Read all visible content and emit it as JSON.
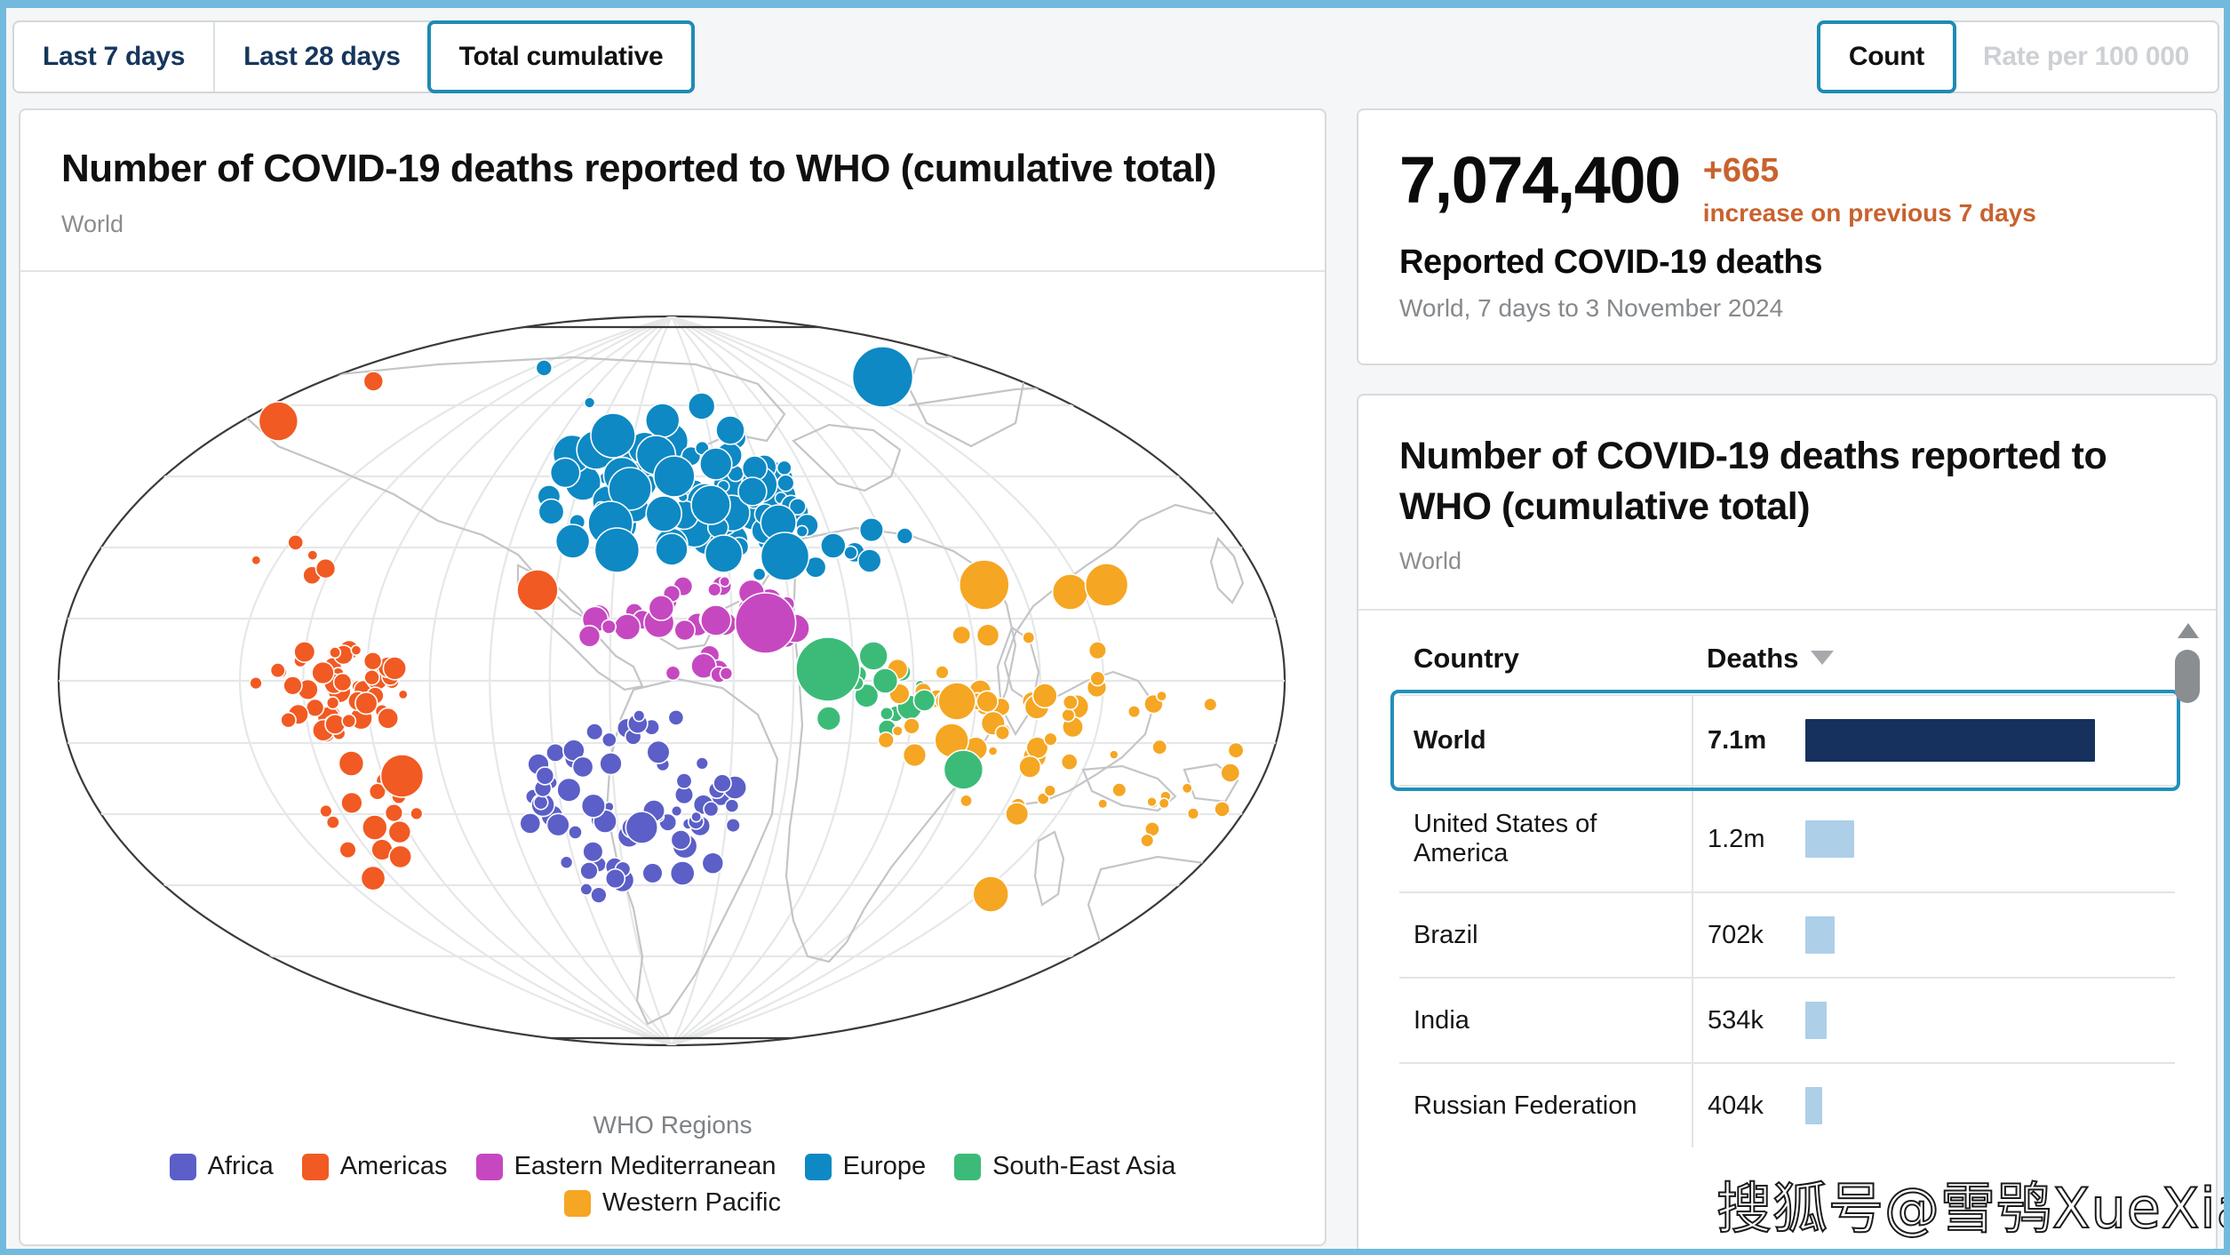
{
  "toolbar": {
    "period_options": [
      {
        "label": "Last 7 days",
        "active": false
      },
      {
        "label": "Last 28 days",
        "active": false
      },
      {
        "label": "Total cumulative",
        "active": true
      }
    ],
    "measure_options": [
      {
        "label": "Count",
        "active": true
      },
      {
        "label": "Rate per 100 000",
        "active": false,
        "disabled": true
      }
    ]
  },
  "map_panel": {
    "title": "Number of COVID-19 deaths reported to WHO (cumulative total)",
    "subtitle": "World",
    "legend_title": "WHO Regions",
    "legend": [
      {
        "label": "Africa",
        "color": "#5B5FC7"
      },
      {
        "label": "Americas",
        "color": "#F15A22"
      },
      {
        "label": "Eastern Mediterranean",
        "color": "#C648C0"
      },
      {
        "label": "Europe",
        "color": "#0E89C4"
      },
      {
        "label": "South-East Asia",
        "color": "#3CBB78"
      },
      {
        "label": "Western Pacific",
        "color": "#F5A623"
      }
    ]
  },
  "kpi": {
    "value": "7,074,400",
    "delta": "+665",
    "delta_note": "increase on previous 7 days",
    "label": "Reported COVID-19 deaths",
    "sub": "World, 7 days to 3 November 2024"
  },
  "table_panel": {
    "title": "Number of COVID-19 deaths reported to WHO (cumulative total)",
    "subtitle": "World",
    "columns": [
      "Country",
      "Deaths"
    ],
    "sort": {
      "column": "Deaths",
      "direction": "desc"
    },
    "rows": [
      {
        "country": "World",
        "deaths": "7.1m",
        "bar_pct": 100,
        "selected": true
      },
      {
        "country": "United States of America",
        "deaths": "1.2m",
        "bar_pct": 17,
        "selected": false
      },
      {
        "country": "Brazil",
        "deaths": "702k",
        "bar_pct": 10,
        "selected": false
      },
      {
        "country": "India",
        "deaths": "534k",
        "bar_pct": 7.5,
        "selected": false
      },
      {
        "country": "Russian Federation",
        "deaths": "404k",
        "bar_pct": 5.7,
        "selected": false
      }
    ],
    "colors": {
      "selected_bar": "#16315E",
      "bar": "#ADCFE8",
      "selected_outline": "#2190BB"
    }
  },
  "watermark": {
    "text": "搜狐号@雪鸮XueXiao"
  },
  "chart_data": {
    "type": "scatter",
    "title": "Number of COVID-19 deaths reported to WHO (cumulative total)",
    "subtitle": "World",
    "projection": "globe / orthographic-style world map",
    "legend_title": "WHO Regions",
    "legend_position": "bottom-center",
    "series": [
      {
        "name": "Africa",
        "color": "#5B5FC7"
      },
      {
        "name": "Americas",
        "color": "#F15A22"
      },
      {
        "name": "Eastern Mediterranean",
        "color": "#C648C0"
      },
      {
        "name": "Europe",
        "color": "#0E89C4"
      },
      {
        "name": "South-East Asia",
        "color": "#3CBB78"
      },
      {
        "name": "Western Pacific",
        "color": "#F5A623"
      }
    ],
    "encoding": {
      "size": "cumulative deaths",
      "color": "WHO region"
    },
    "table": {
      "columns": [
        "Country",
        "Deaths"
      ],
      "rows": [
        [
          "World",
          "7.1m"
        ],
        [
          "United States of America",
          "1.2m"
        ],
        [
          "Brazil",
          "702k"
        ],
        [
          "India",
          "534k"
        ],
        [
          "Russian Federation",
          "404k"
        ]
      ]
    },
    "bubbles": [
      {
        "r": 9,
        "cx": 0.402,
        "cy": 0.108,
        "region": "Europe"
      },
      {
        "r": 6,
        "cx": 0.437,
        "cy": 0.147,
        "region": "Europe"
      },
      {
        "r": 22,
        "cx": 0.198,
        "cy": 0.168,
        "region": "Americas"
      },
      {
        "r": 11,
        "cx": 0.271,
        "cy": 0.123,
        "region": "Americas"
      },
      {
        "r": 34,
        "cx": 0.662,
        "cy": 0.118,
        "region": "Europe"
      },
      {
        "r": 25,
        "cx": 0.455,
        "cy": 0.184,
        "region": "Europe"
      },
      {
        "r": 19,
        "cx": 0.493,
        "cy": 0.167,
        "region": "Europe"
      },
      {
        "r": 22,
        "cx": 0.488,
        "cy": 0.206,
        "region": "Europe"
      },
      {
        "r": 15,
        "cx": 0.523,
        "cy": 0.151,
        "region": "Europe"
      },
      {
        "r": 16,
        "cx": 0.545,
        "cy": 0.178,
        "region": "Europe"
      },
      {
        "r": 24,
        "cx": 0.468,
        "cy": 0.244,
        "region": "Europe"
      },
      {
        "r": 23,
        "cx": 0.502,
        "cy": 0.23,
        "region": "Europe"
      },
      {
        "r": 18,
        "cx": 0.534,
        "cy": 0.216,
        "region": "Europe"
      },
      {
        "r": 25,
        "cx": 0.453,
        "cy": 0.283,
        "region": "Europe"
      },
      {
        "r": 20,
        "cx": 0.494,
        "cy": 0.272,
        "region": "Europe"
      },
      {
        "r": 22,
        "cx": 0.53,
        "cy": 0.262,
        "region": "Europe"
      },
      {
        "r": 16,
        "cx": 0.562,
        "cy": 0.247,
        "region": "Europe"
      },
      {
        "r": 20,
        "cx": 0.582,
        "cy": 0.282,
        "region": "Europe"
      },
      {
        "r": 19,
        "cx": 0.424,
        "cy": 0.303,
        "region": "Europe"
      },
      {
        "r": 25,
        "cx": 0.458,
        "cy": 0.313,
        "region": "Europe"
      },
      {
        "r": 18,
        "cx": 0.5,
        "cy": 0.312,
        "region": "Europe"
      },
      {
        "r": 21,
        "cx": 0.54,
        "cy": 0.317,
        "region": "Europe"
      },
      {
        "r": 27,
        "cx": 0.587,
        "cy": 0.32,
        "region": "Europe"
      },
      {
        "r": 14,
        "cx": 0.624,
        "cy": 0.308,
        "region": "Europe"
      },
      {
        "r": 13,
        "cx": 0.652,
        "cy": 0.325,
        "region": "Europe"
      },
      {
        "r": 9,
        "cx": 0.679,
        "cy": 0.297,
        "region": "Europe"
      },
      {
        "r": 23,
        "cx": 0.397,
        "cy": 0.358,
        "region": "Americas"
      },
      {
        "r": 28,
        "cx": 0.74,
        "cy": 0.352,
        "region": "Western Pacific"
      },
      {
        "r": 20,
        "cx": 0.806,
        "cy": 0.36,
        "region": "Western Pacific"
      },
      {
        "r": 24,
        "cx": 0.834,
        "cy": 0.352,
        "region": "Western Pacific"
      },
      {
        "r": 34,
        "cx": 0.572,
        "cy": 0.395,
        "region": "Eastern Mediterranean"
      },
      {
        "r": 17,
        "cx": 0.534,
        "cy": 0.392,
        "region": "Eastern Mediterranean"
      },
      {
        "r": 14,
        "cx": 0.492,
        "cy": 0.378,
        "region": "Eastern Mediterranean"
      },
      {
        "r": 36,
        "cx": 0.62,
        "cy": 0.447,
        "region": "South-East Asia"
      },
      {
        "r": 16,
        "cx": 0.655,
        "cy": 0.432,
        "region": "South-East Asia"
      },
      {
        "r": 14,
        "cx": 0.664,
        "cy": 0.46,
        "region": "South-East Asia"
      },
      {
        "r": 12,
        "cx": 0.694,
        "cy": 0.482,
        "region": "South-East Asia"
      },
      {
        "r": 19,
        "cx": 0.715,
        "cy": 0.527,
        "region": "Western Pacific"
      },
      {
        "r": 21,
        "cx": 0.719,
        "cy": 0.483,
        "region": "Western Pacific"
      },
      {
        "r": 22,
        "cx": 0.724,
        "cy": 0.56,
        "region": "South-East Asia"
      },
      {
        "r": 14,
        "cx": 0.254,
        "cy": 0.553,
        "region": "Americas"
      },
      {
        "r": 24,
        "cx": 0.293,
        "cy": 0.567,
        "region": "Americas"
      },
      {
        "r": 14,
        "cx": 0.272,
        "cy": 0.625,
        "region": "Americas"
      },
      {
        "r": 20,
        "cx": 0.745,
        "cy": 0.7,
        "region": "Western Pacific"
      },
      {
        "r": 18,
        "cx": 0.477,
        "cy": 0.625,
        "region": "Africa"
      }
    ]
  }
}
